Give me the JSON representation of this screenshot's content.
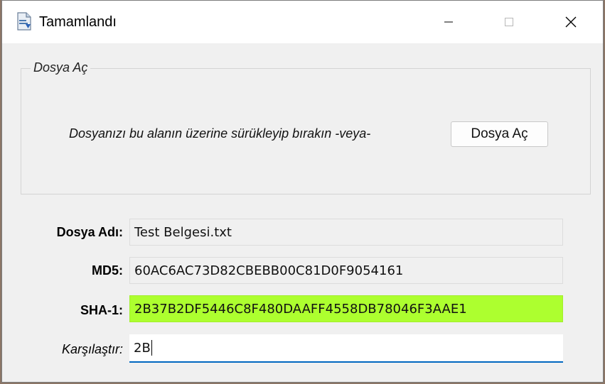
{
  "window": {
    "title": "Tamamlandı"
  },
  "open_group": {
    "legend": "Dosya Aç",
    "drop_instruction": "Dosyanızı bu alanın üzerine sürükleyip bırakın -veya-",
    "open_button": "Dosya Aç"
  },
  "fields": {
    "filename": {
      "label": "Dosya Adı:",
      "value": "Test Belgesi.txt"
    },
    "md5": {
      "label": "MD5:",
      "value": "60AC6AC73D82CBEBB00C81D0F9054161"
    },
    "sha1": {
      "label": "SHA-1:",
      "value": "2B37B2DF5446C8F480DAAFF4558DB78046F3AAE1"
    },
    "compare": {
      "label": "Karşılaştır:",
      "value": "2B"
    }
  },
  "colors": {
    "match_highlight": "#adff2f",
    "input_focus": "#0067c0"
  }
}
